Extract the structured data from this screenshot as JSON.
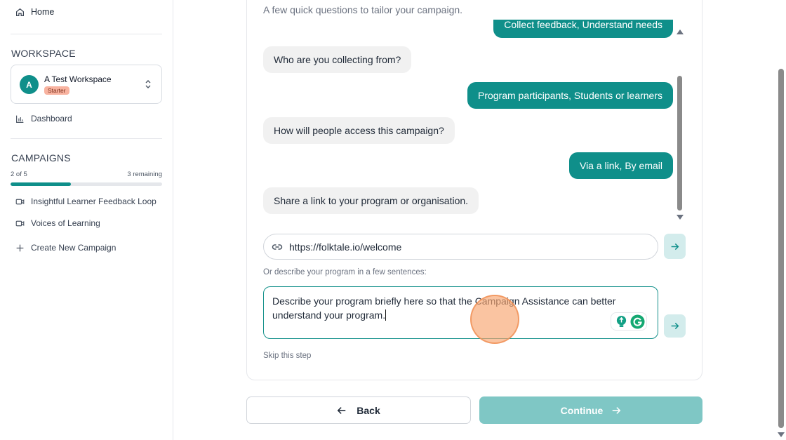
{
  "sidebar": {
    "home_label": "Home",
    "workspace_heading": "WORKSPACE",
    "workspace": {
      "avatar_letter": "A",
      "name": "A Test Workspace",
      "plan_badge": "Starter"
    },
    "dashboard_label": "Dashboard",
    "campaigns_heading": "CAMPAIGNS",
    "usage": {
      "count_text": "2 of 5",
      "remaining_text": "3 remaining",
      "used": 2,
      "total": 5
    },
    "campaigns": [
      {
        "label": "Insightful Learner Feedback Loop"
      },
      {
        "label": "Voices of Learning"
      }
    ],
    "create_label": "Create New Campaign"
  },
  "main": {
    "subtitle": "A few quick questions to tailor your campaign.",
    "messages": [
      {
        "role": "user",
        "text": "Collect feedback, Understand needs"
      },
      {
        "role": "bot",
        "text": "Who are you collecting from?"
      },
      {
        "role": "user",
        "text": "Program participants, Students or learners"
      },
      {
        "role": "bot",
        "text": "How will people access this campaign?"
      },
      {
        "role": "user",
        "text": "Via a link, By email"
      },
      {
        "role": "bot",
        "text": "Share a link to your program or organisation."
      }
    ],
    "url_value": "https://folktale.io/welcome",
    "or_text": "Or describe your program in a few sentences:",
    "description_value": "Describe your program briefly here so that the Campaign Assistance can better understand your program.",
    "skip_label": "Skip this step"
  },
  "footer": {
    "back_label": "Back",
    "continue_label": "Continue"
  },
  "colors": {
    "accent": "#0f8f8a",
    "accent_light": "#7fc7c5",
    "badge": "#f8b3a0"
  }
}
